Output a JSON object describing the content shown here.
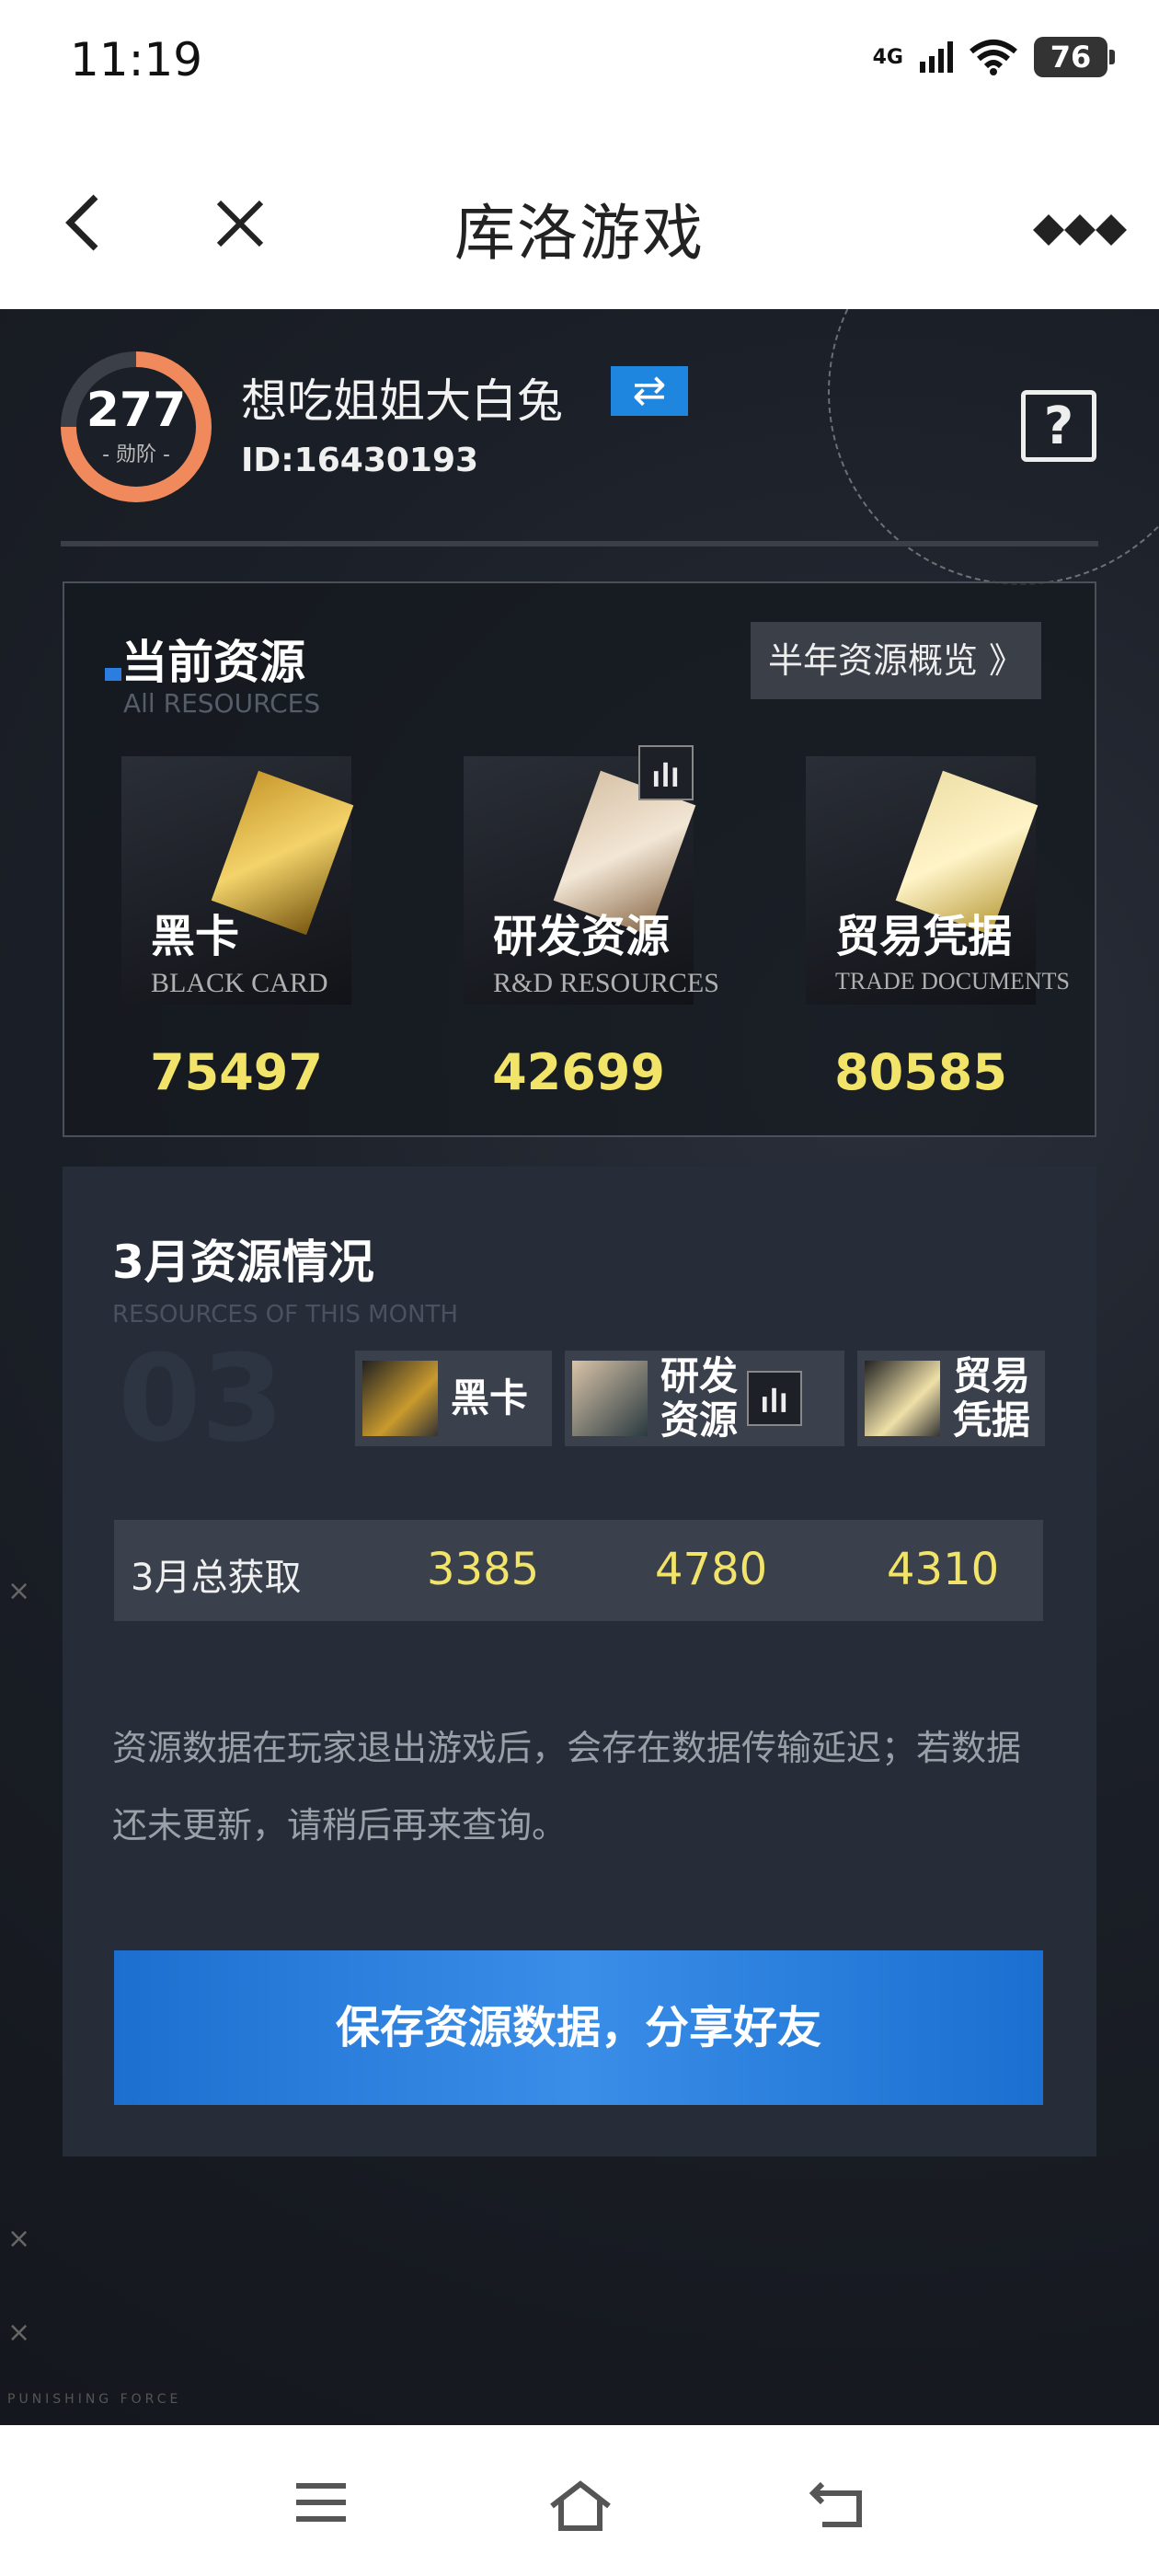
{
  "status": {
    "time": "11:19",
    "network": "4G",
    "battery": "76"
  },
  "nav": {
    "title": "库洛游戏"
  },
  "profile": {
    "rank_value": "277",
    "rank_label": "- 勋阶 -",
    "username": "想吃姐姐大白兔",
    "swap_icon": "⇄",
    "user_id": "ID:16430193",
    "help_icon": "?"
  },
  "resources": {
    "title": "当前资源",
    "subtitle": "All RESOURCES",
    "overview_button": "半年资源概览 》",
    "items": [
      {
        "name": "黑卡",
        "en": "BLACK CARD",
        "value": "75497"
      },
      {
        "name": "研发资源",
        "en": "R&D RESOURCES",
        "value": "42699"
      },
      {
        "name": "贸易凭据",
        "en": "TRADE DOCUMENTS",
        "value": "80585"
      }
    ]
  },
  "month": {
    "title": "3月资源情况",
    "subtitle": "RESOURCES OF THIS MONTH",
    "bg_number": "03",
    "headers": [
      "黑卡",
      "研发\n资源",
      "贸易\n凭据"
    ],
    "total_label": "3月总获取",
    "totals": [
      "3385",
      "4780",
      "4310"
    ],
    "note": "资源数据在玩家退出游戏后，会存在数据传输延迟；若数据还未更新，请稍后再来查询。",
    "share_button": "保存资源数据，分享好友"
  },
  "brand": "PUNISHING FORCE",
  "colors": {
    "accent_blue": "#1f86e0",
    "value_yellow": "#f1e468",
    "rank_orange": "#f08a5d"
  }
}
